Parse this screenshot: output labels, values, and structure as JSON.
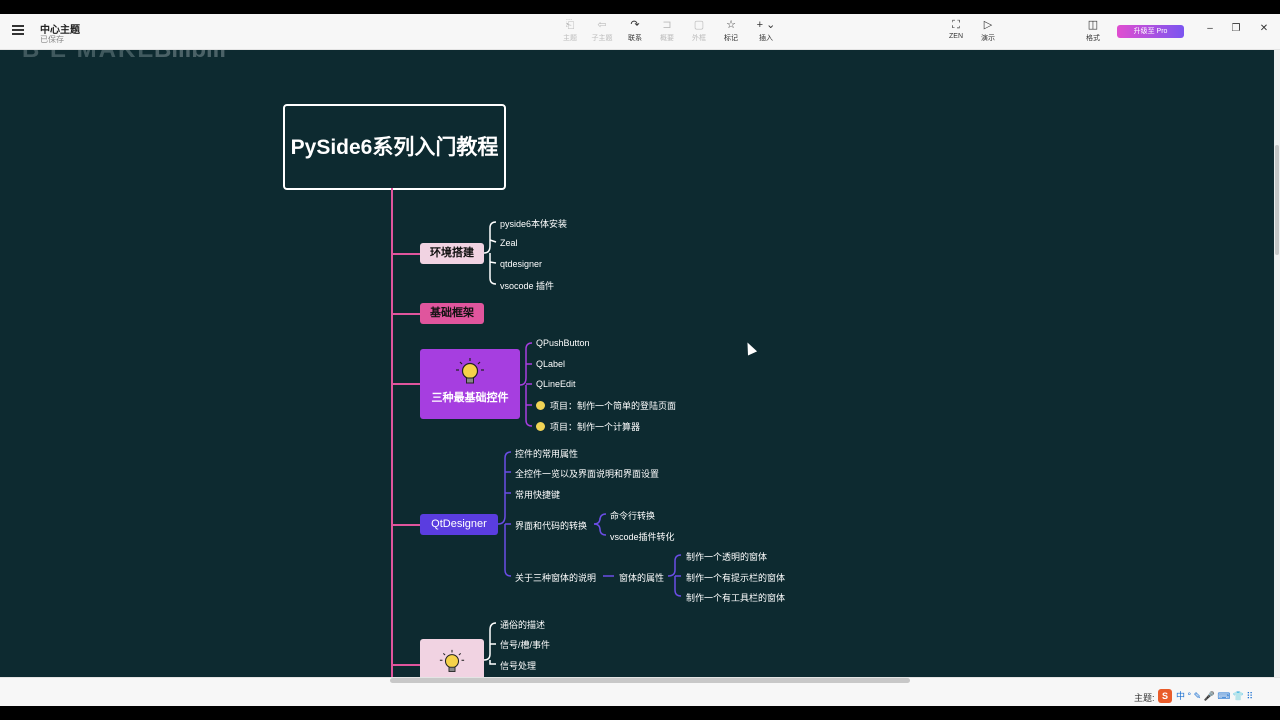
{
  "app": {
    "title": "中心主题",
    "subtitle": "已保存"
  },
  "toolbar": {
    "items": [
      {
        "icon": "subtopic-icon",
        "label": "主题",
        "active": false
      },
      {
        "icon": "sibling-topic-icon",
        "label": "子主题",
        "active": false
      },
      {
        "icon": "relation-icon",
        "label": "联系",
        "active": true
      },
      {
        "icon": "summary-icon",
        "label": "概要",
        "active": false
      },
      {
        "icon": "boundary-icon",
        "label": "外框",
        "active": false
      },
      {
        "icon": "star-icon",
        "label": "标记",
        "active": true
      },
      {
        "icon": "plus-icon",
        "label": "插入",
        "active": true
      }
    ],
    "zen_label": "ZEN",
    "present_label": "演示",
    "format_label": "格式",
    "upgrade_label": "升级至 Pro"
  },
  "watermark": {
    "left": "B E MAKE",
    "right": "Bilibili"
  },
  "mindmap": {
    "root": "PySide6系列入门教程",
    "branches": [
      {
        "label": "环境搭建",
        "children": [
          "pyside6本体安装",
          "Zeal",
          "qtdesigner",
          "vsocode 插件"
        ]
      },
      {
        "label": "基础框架",
        "children": []
      },
      {
        "label": "三种最基础控件",
        "children": [
          "QPushButton",
          "QLabel",
          "QLineEdit",
          "项目：制作一个简单的登陆页面",
          "项目：制作一个计算器"
        ]
      },
      {
        "label": "QtDesigner",
        "children": [
          "控件的常用属性",
          "全控件一览以及界面说明和界面设置",
          "常用快捷键",
          "界面和代码的转换",
          "关于三种窗体的说明"
        ],
        "sub_convert": [
          "命令行转换",
          "vscode插件转化"
        ],
        "sub_window_attr": "窗体的属性",
        "sub_window_items": [
          "制作一个透明的窗体",
          "制作一个有提示栏的窗体",
          "制作一个有工具栏的窗体"
        ]
      },
      {
        "label": "",
        "children": [
          "通俗的描述",
          "信号/槽/事件",
          "信号处理"
        ]
      }
    ]
  },
  "status": {
    "theme_label": "主题:",
    "ime_text": "中 ° ✎ 🎤 ⌨ 👕 ⠿"
  },
  "colors": {
    "canvas_bg": "#0d2a30",
    "trunk": "#e0559d",
    "branch1_bg": "#f1d3e2",
    "branch2_bg": "#e0559d",
    "branch3_bg": "#a63ee0",
    "branch4_bg": "#5a3de0",
    "connector_purple": "#6b4de6"
  }
}
